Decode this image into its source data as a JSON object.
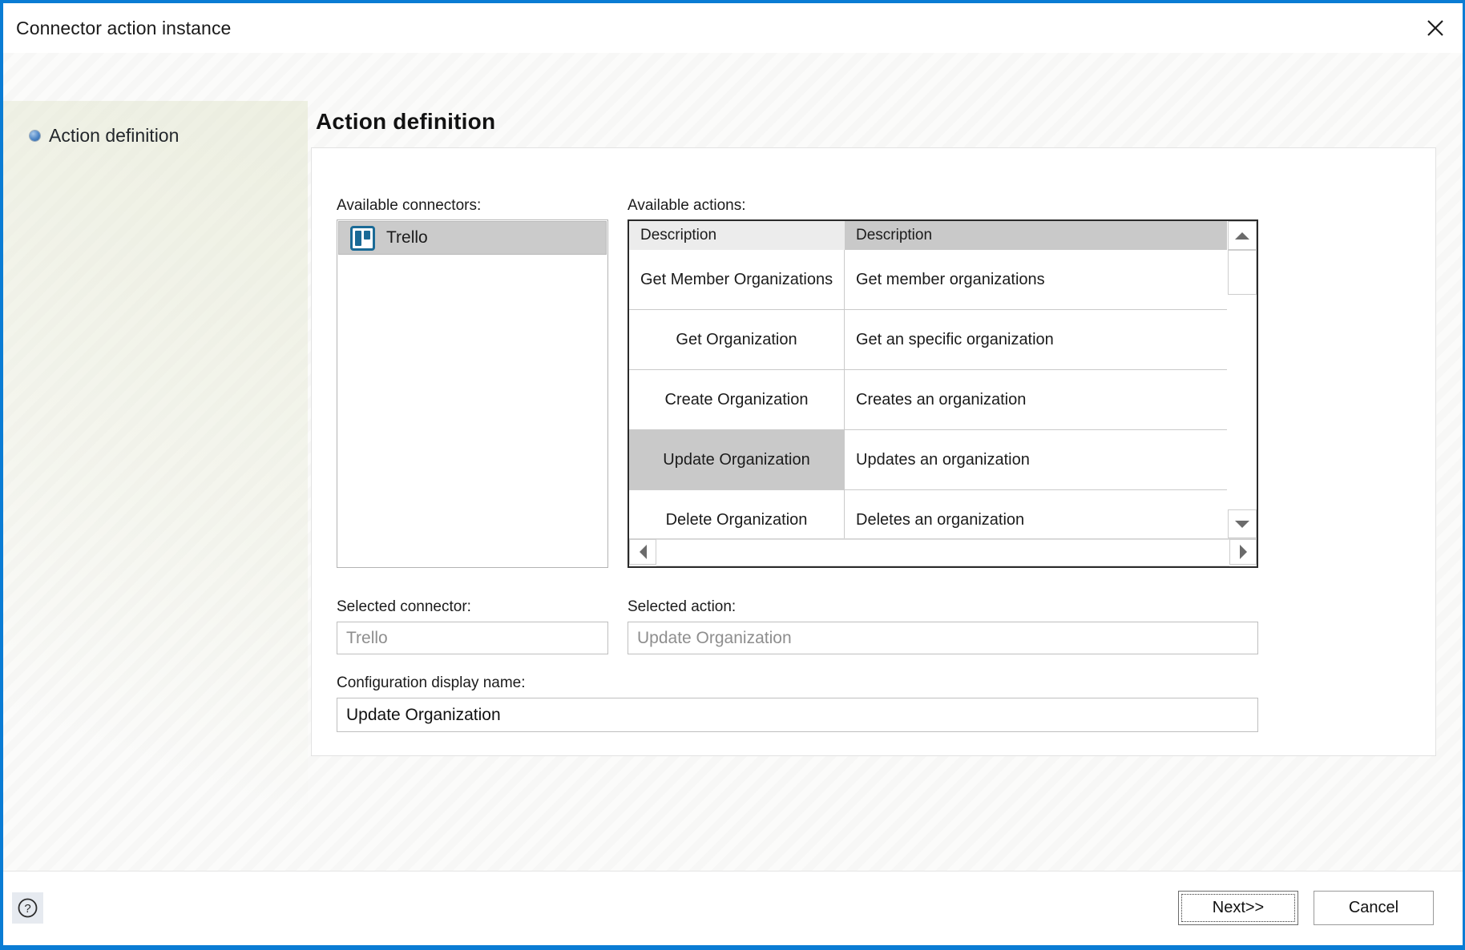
{
  "window": {
    "title": "Connector action instance",
    "close_icon": "close-icon",
    "accent_color": "#0a7cd4"
  },
  "sidebar": {
    "items": [
      {
        "label": "Action definition",
        "bullet_icon": "blue-sphere-bullet-icon",
        "active": true
      }
    ]
  },
  "main": {
    "page_title": "Action definition",
    "connectors": {
      "label": "Available connectors:",
      "items": [
        {
          "name": "Trello",
          "icon": "trello-icon",
          "selected": true
        }
      ]
    },
    "actions": {
      "label": "Available actions:",
      "columns": [
        "Description",
        "Description"
      ],
      "rows": [
        {
          "name": "Get Member Organizations",
          "description": "Get member organizations",
          "selected": false
        },
        {
          "name": "Get Organization",
          "description": "Get an specific organization",
          "selected": false
        },
        {
          "name": "Create Organization",
          "description": "Creates an organization",
          "selected": false
        },
        {
          "name": "Update Organization",
          "description": "Updates an organization",
          "selected": true
        },
        {
          "name": "Delete Organization",
          "description": "Deletes an organization",
          "selected": false
        }
      ],
      "scrollbars": {
        "vertical": {
          "up_icon": "scroll-up-arrow-icon",
          "down_icon": "scroll-down-arrow-icon"
        },
        "horizontal": {
          "left_icon": "scroll-left-arrow-icon",
          "right_icon": "scroll-right-arrow-icon"
        }
      }
    },
    "selected_connector": {
      "label": "Selected connector:",
      "value": "Trello",
      "enabled": false
    },
    "selected_action": {
      "label": "Selected action:",
      "value": "Update Organization",
      "enabled": false
    },
    "display_name": {
      "label": "Configuration display name:",
      "value": "Update Organization",
      "enabled": true
    }
  },
  "footer": {
    "help_icon": "help-question-mark-icon",
    "next_label": "Next>>",
    "cancel_label": "Cancel"
  }
}
